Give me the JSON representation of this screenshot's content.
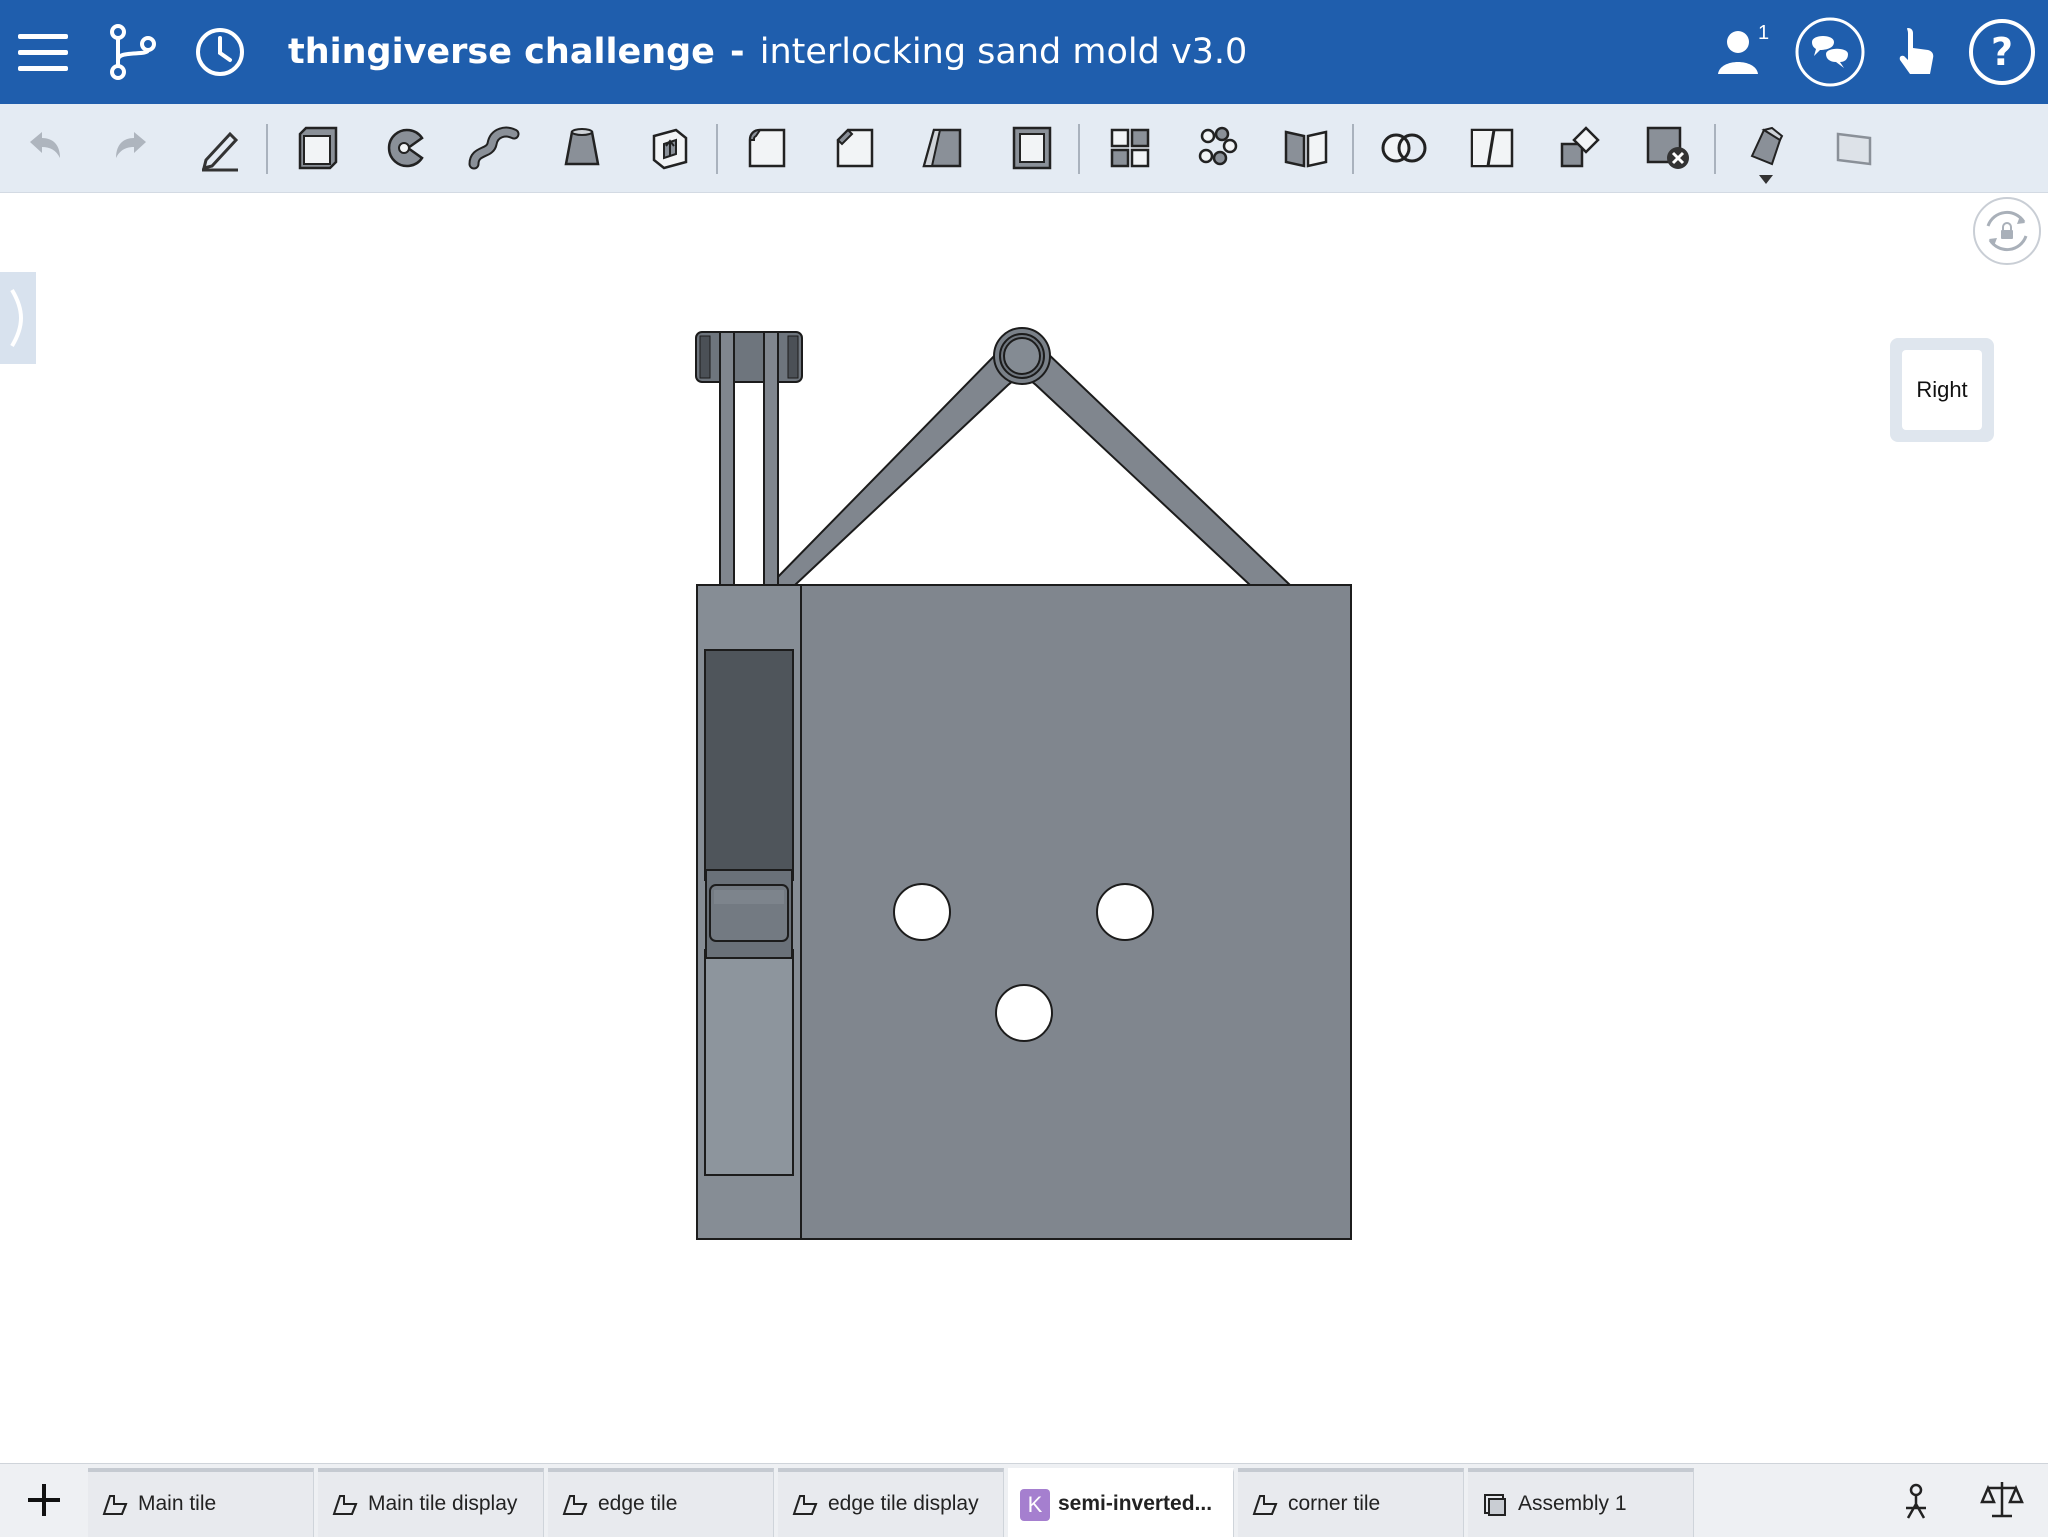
{
  "header": {
    "document_name": "thingiverse challenge",
    "separator": "-",
    "workspace_name": "interlocking sand mold v3.0",
    "collaborator_count": "1"
  },
  "viewcube": {
    "label": "Right"
  },
  "tabs": [
    {
      "label": "Main tile",
      "icon": "part-studio-icon",
      "active": false
    },
    {
      "label": "Main tile display",
      "icon": "part-studio-icon",
      "active": false
    },
    {
      "label": "edge tile",
      "icon": "part-studio-icon",
      "active": false
    },
    {
      "label": "edge tile display",
      "icon": "part-studio-icon",
      "active": false
    },
    {
      "label": "semi-inverted...",
      "icon": "featurescript-icon",
      "badge": "K",
      "active": true
    },
    {
      "label": "corner tile",
      "icon": "part-studio-icon",
      "active": false
    },
    {
      "label": "Assembly 1",
      "icon": "assembly-icon",
      "active": false
    }
  ],
  "colors": {
    "header_bg": "#1f5ead",
    "toolbar_bg": "#e4ebf3",
    "model_gray": "#80868e",
    "badge_purple": "#a57fcf"
  }
}
